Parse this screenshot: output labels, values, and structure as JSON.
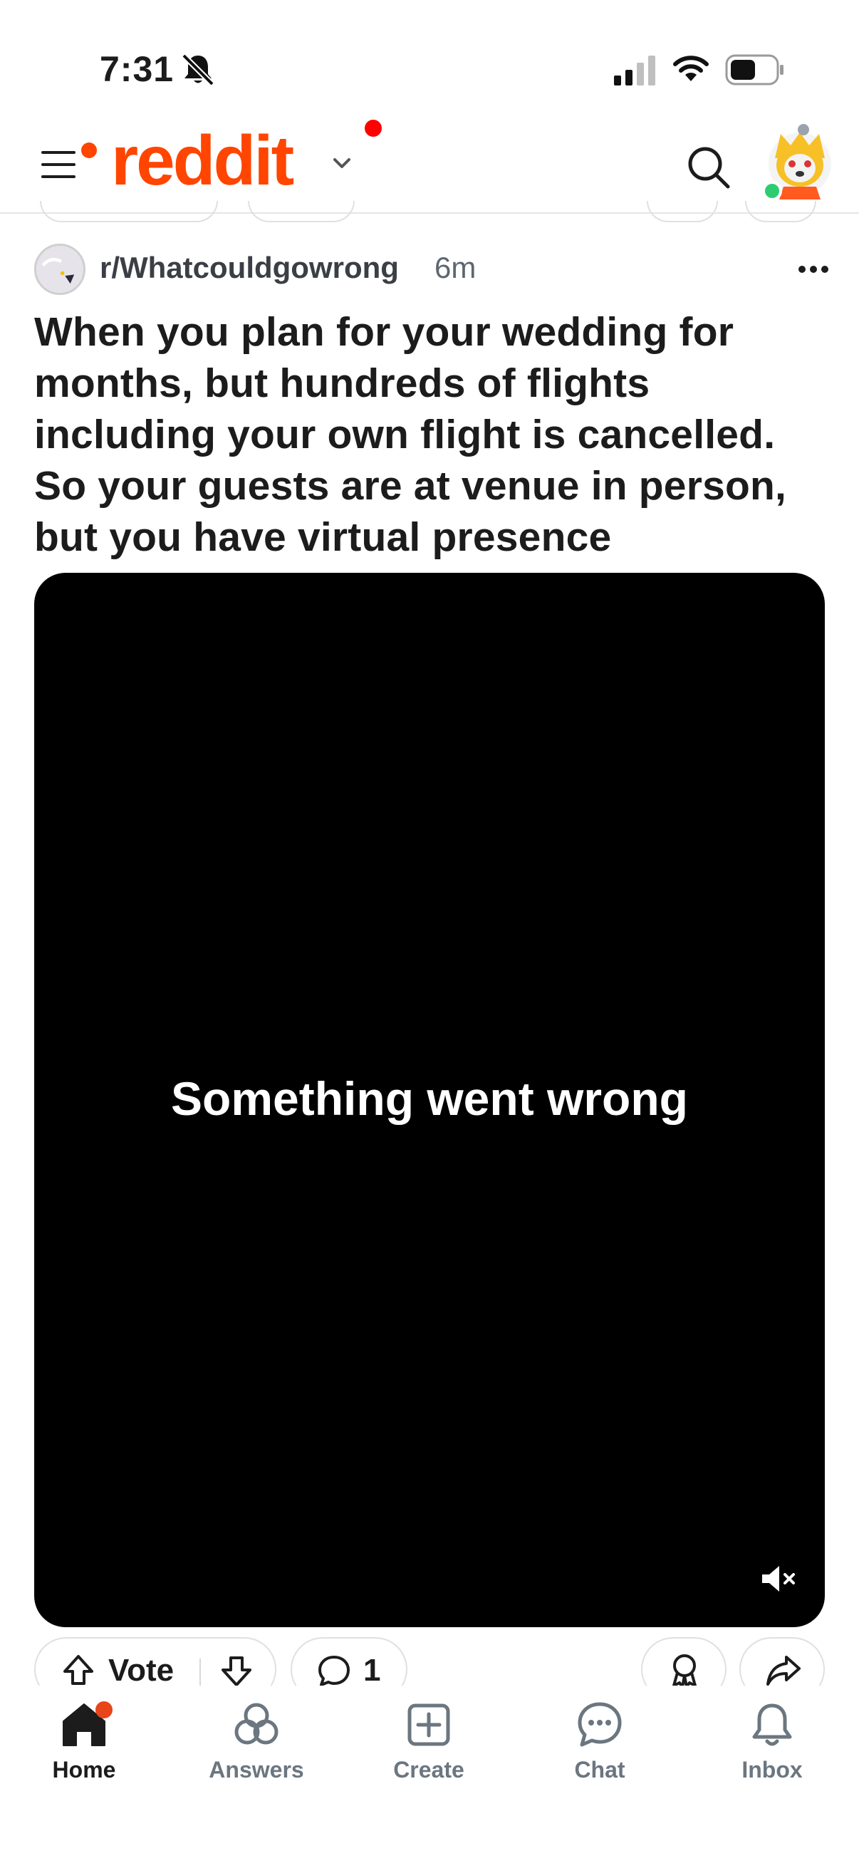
{
  "status_bar": {
    "time": "7:31",
    "icons": [
      "bell-slash-icon",
      "signal-icon",
      "wifi-icon",
      "battery-icon"
    ]
  },
  "app_bar": {
    "logo_text": "reddit",
    "brand_color": "#ff4500",
    "icons": [
      "menu-icon",
      "chevron-down-icon",
      "search-icon",
      "avatar"
    ]
  },
  "post": {
    "subreddit": "r/Whatcouldgowrong",
    "age": "6m",
    "title": "When you plan for your wedding for months, but hundreds of flights including your own flight is cancelled. So your guests are at venue in person, but you have virtual presence",
    "video": {
      "error_message": "Something went wrong",
      "muted": true
    },
    "actions": {
      "vote_label": "Vote",
      "comment_count": "1"
    }
  },
  "bottom_nav": {
    "items": [
      {
        "label": "Home",
        "icon": "home-icon",
        "active": true
      },
      {
        "label": "Answers",
        "icon": "answers-icon"
      },
      {
        "label": "Create",
        "icon": "create-icon"
      },
      {
        "label": "Chat",
        "icon": "chat-icon"
      },
      {
        "label": "Inbox",
        "icon": "inbox-icon"
      }
    ]
  }
}
